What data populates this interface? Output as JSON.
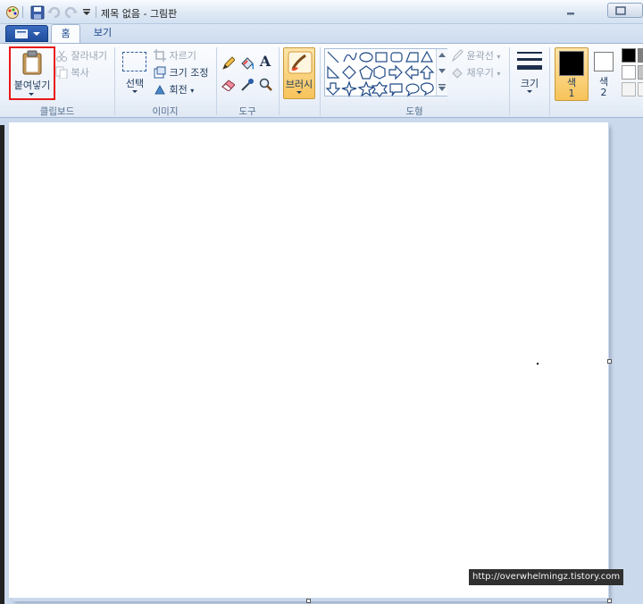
{
  "window": {
    "title": "제목 없음 - 그림판"
  },
  "quick_access": {
    "items": [
      "save-icon",
      "undo-icon",
      "redo-icon",
      "customize-icon"
    ]
  },
  "tabs": [
    {
      "label": "홈",
      "selected": true
    },
    {
      "label": "보기",
      "selected": false
    }
  ],
  "ribbon": {
    "clipboard": {
      "paste": "붙여넣기",
      "cut": "잘라내기",
      "copy": "복사",
      "group_label": "클립보드"
    },
    "image": {
      "select": "선택",
      "crop": "자르기",
      "resize": "크기 조정",
      "rotate": "회전",
      "group_label": "이미지"
    },
    "tools": {
      "group_label": "도구"
    },
    "brush": {
      "label": "브러시"
    },
    "shapes": {
      "outline": "윤곽선",
      "fill": "채우기",
      "group_label": "도형"
    },
    "size": {
      "label": "크기"
    },
    "color1": {
      "label_line1": "색",
      "label_line2": "1",
      "color": "#000000"
    },
    "color2": {
      "label_line1": "색",
      "label_line2": "2",
      "color": "#ffffff"
    }
  },
  "watermark": "http://overwhelmingz.tistory.com",
  "colors": {
    "highlight": "#e81818",
    "brush_active": "#f7c35a",
    "accent": "#2b5797"
  }
}
